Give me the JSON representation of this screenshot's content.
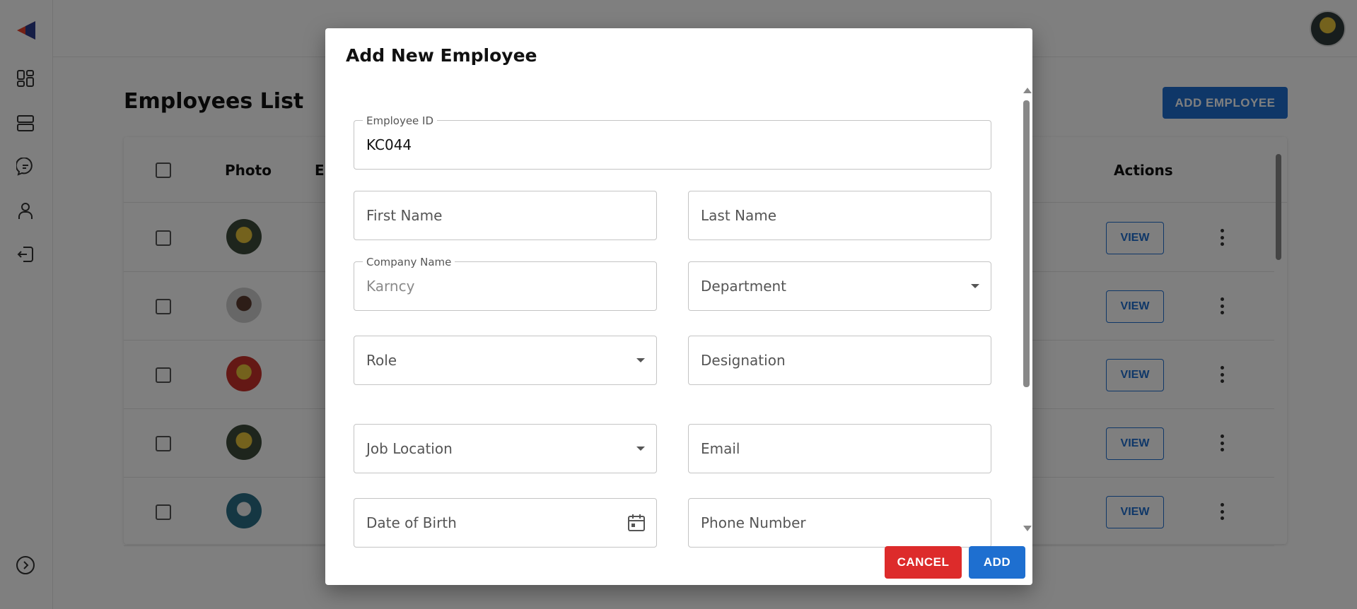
{
  "colors": {
    "primary": "#1e6fd0",
    "danger": "#dd2b2b"
  },
  "page": {
    "title": "Employees List",
    "add_button": "ADD EMPLOYEE"
  },
  "sidebar": {
    "items": [
      {
        "icon": "dashboard-icon"
      },
      {
        "icon": "list-icon"
      },
      {
        "icon": "chat-icon"
      },
      {
        "icon": "user-icon"
      },
      {
        "icon": "logout-icon"
      }
    ],
    "expand_icon": "chevron-right-circle-icon"
  },
  "table": {
    "headers": {
      "photo": "Photo",
      "employee_partial": "Em",
      "actions": "Actions"
    },
    "rows": [
      {
        "view": "VIEW"
      },
      {
        "view": "VIEW"
      },
      {
        "view": "VIEW"
      },
      {
        "view": "VIEW"
      },
      {
        "view": "VIEW"
      }
    ]
  },
  "dialog": {
    "title": "Add New Employee",
    "fields": {
      "employee_id": {
        "label": "Employee ID",
        "value": "KC044"
      },
      "first_name": {
        "placeholder": "First Name"
      },
      "last_name": {
        "placeholder": "Last Name"
      },
      "company_name": {
        "label": "Company Name",
        "value": "Karncy"
      },
      "department": {
        "placeholder": "Department"
      },
      "role": {
        "placeholder": "Role"
      },
      "designation": {
        "placeholder": "Designation"
      },
      "job_location": {
        "placeholder": "Job Location"
      },
      "email": {
        "placeholder": "Email"
      },
      "date_of_birth": {
        "placeholder": "Date of Birth"
      },
      "phone_number": {
        "placeholder": "Phone Number"
      }
    },
    "cancel": "CANCEL",
    "add": "ADD"
  }
}
